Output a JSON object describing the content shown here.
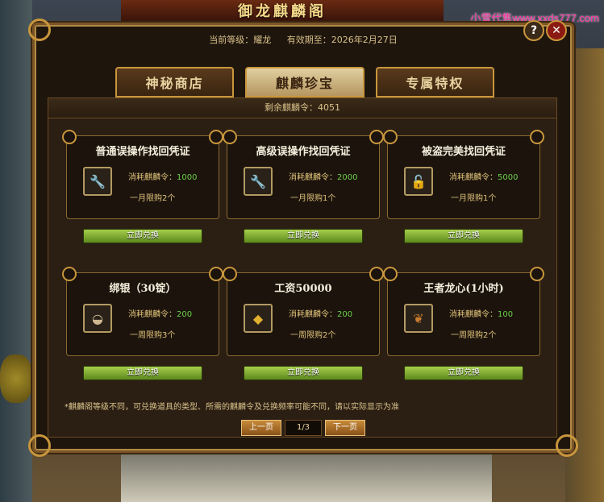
{
  "banner_title": "御龙麒麟阁",
  "watermark": "小雪代售www.xxds777.com",
  "header": {
    "level_label": "当前等级：耀龙",
    "expiry_label": "有效期至：2026年2月27日",
    "help": "?",
    "close": "✕"
  },
  "tabs": [
    {
      "label": "神秘商店"
    },
    {
      "label": "麒麟珍宝",
      "active": true
    },
    {
      "label": "专属特权"
    }
  ],
  "remaining": "剩余麒麟令：4051",
  "items": [
    {
      "title": "普通误操作找回凭证",
      "cost_label": "消耗麒麟令：",
      "cost": "1000",
      "limit": "一月限购2个",
      "icon": "wrench-icon",
      "button": "立即兑换"
    },
    {
      "title": "高级误操作找回凭证",
      "cost_label": "消耗麒麟令：",
      "cost": "2000",
      "limit": "一月限购1个",
      "icon": "wrench-icon",
      "button": "立即兑换"
    },
    {
      "title": "被盗完美找回凭证",
      "cost_label": "消耗麒麟令：",
      "cost": "5000",
      "limit": "一月限购1个",
      "icon": "lock-icon",
      "button": "立即兑换"
    },
    {
      "title": "绑银（30锭）",
      "cost_label": "消耗麒麟令：",
      "cost": "200",
      "limit": "一周限购3个",
      "icon": "silver-ingot-icon",
      "button": "立即兑换"
    },
    {
      "title": "工资50000",
      "cost_label": "消耗麒麟令：",
      "cost": "200",
      "limit": "一周限购2个",
      "icon": "gold-ingot-icon",
      "button": "立即兑换"
    },
    {
      "title": "王者龙心(1小时)",
      "cost_label": "消耗麒麟令：",
      "cost": "100",
      "limit": "一周限购2个",
      "icon": "dragon-heart-icon",
      "button": "立即兑换"
    }
  ],
  "note": "*麒麟阁等级不同，可兑换道具的类型、所需的麒麟令及兑换频率可能不同，请以实际显示为准",
  "pager": {
    "prev": "上一页",
    "page": "1/3",
    "next": "下一页"
  }
}
